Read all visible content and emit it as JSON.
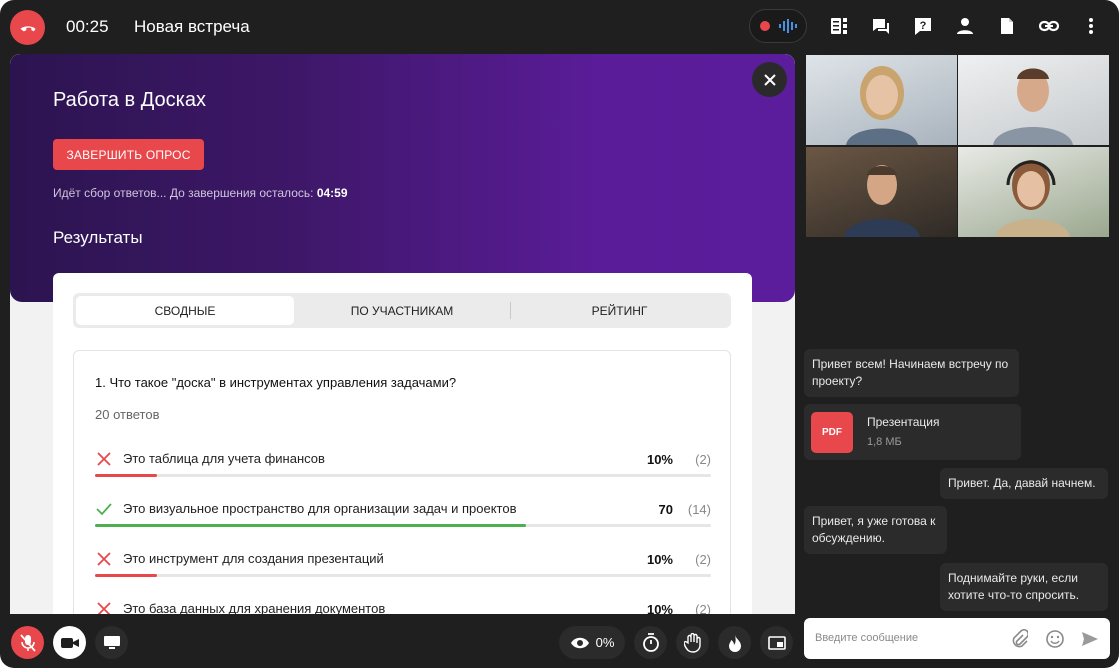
{
  "header": {
    "timer": "00:25",
    "title": "Новая встреча",
    "icons": [
      "end-call-icon",
      "recording-icon",
      "audio-wave-icon",
      "board-icon",
      "chat-icon",
      "help-icon",
      "participants-icon",
      "document-icon",
      "link-icon",
      "more-icon"
    ]
  },
  "poll": {
    "title": "Работа в Досках",
    "finish_label": "ЗАВЕРШИТЬ ОПРОС",
    "status_text": "Идёт сбор ответов...  До завершения осталось:",
    "time_left": "04:59",
    "results_heading": "Результаты",
    "tabs": [
      {
        "label": "СВОДНЫЕ",
        "active": true
      },
      {
        "label": "ПО УЧАСТНИКАМ",
        "active": false
      },
      {
        "label": "РЕЙТИНГ",
        "active": false
      }
    ],
    "question": {
      "text": "1. Что такое \"доска\" в инструментах управления задачами?",
      "answers_count": "20 ответов",
      "answers": [
        {
          "text": "Это таблица для учета финансов",
          "percent": "10%",
          "count": "(2)",
          "correct": false,
          "share": 0.1
        },
        {
          "text": "Это визуальное пространство для организации задач и проектов",
          "percent": "70",
          "count": "(14)",
          "correct": true,
          "share": 0.7
        },
        {
          "text": "Это инструмент для создания презентаций",
          "percent": "10%",
          "count": "(2)",
          "correct": false,
          "share": 0.1
        },
        {
          "text": "Это база данных для хранения документов",
          "percent": "10%",
          "count": "(2)",
          "correct": false,
          "share": 0.1
        }
      ]
    }
  },
  "chat": {
    "messages": [
      {
        "text": "Привет всем! Начинаем встречу по проекту?",
        "own": false
      },
      {
        "text": "Привет. Да, давай начнем.",
        "own": true
      },
      {
        "text": "Привет, я уже готова к обсуждению.",
        "own": false
      },
      {
        "text": "Поднимайте руки, если хотите что-то спросить.",
        "own": true
      }
    ],
    "file": {
      "badge": "PDF",
      "name": "Презентация",
      "size": "1,8 МБ"
    },
    "input_placeholder": "Введите сообщение"
  },
  "toolbar": {
    "viewers": "0%"
  },
  "colors": {
    "accent_red": "#e8484c",
    "correct_green": "#4caf50",
    "hero_purple": "#5a1c98"
  }
}
